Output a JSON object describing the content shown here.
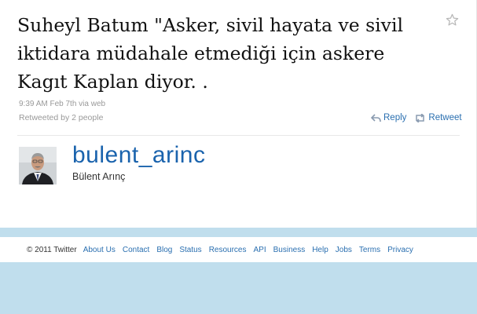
{
  "tweet": {
    "text": "Suheyl Batum \"Asker, sivil hayata ve sivil iktidara müdahale etmediği için askere Kagıt Kaplan diyor. .",
    "time": "9:39 AM Feb 7th",
    "via": "via web",
    "retweeted": "Retweeted by 2 people",
    "reply_label": "Reply",
    "retweet_label": "Retweet"
  },
  "author": {
    "username": "bulent_arinc",
    "name": "Bülent Arınç"
  },
  "footer": {
    "copyright": "© 2011 Twitter",
    "links": [
      "About Us",
      "Contact",
      "Blog",
      "Status",
      "Resources",
      "API",
      "Business",
      "Help",
      "Jobs",
      "Terms",
      "Privacy"
    ]
  },
  "colors": {
    "link": "#2a6fb0",
    "username": "#1a63ad",
    "background": "#c0deed"
  },
  "icons": [
    "star-icon",
    "reply-icon",
    "retweet-icon"
  ]
}
